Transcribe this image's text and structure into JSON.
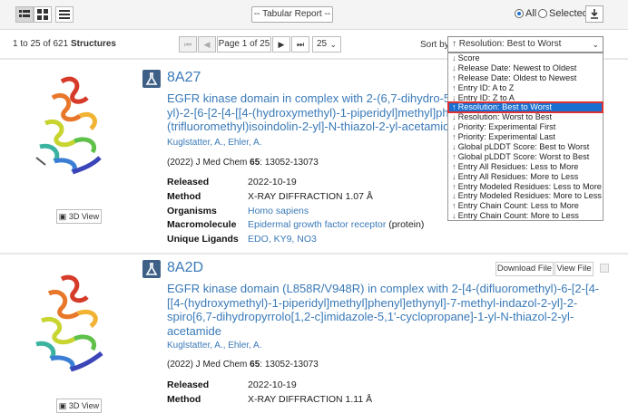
{
  "toolbar": {
    "report_select": "-- Tabular Report --",
    "scope_all": "All",
    "scope_selected": "Selected"
  },
  "pager": {
    "range": "1 to 25 of 621",
    "noun": "Structures",
    "page_text": "Page 1 of 25",
    "per_page": "25",
    "sort_label": "Sort by",
    "sort_value": "↑ Resolution: Best to Worst"
  },
  "sort_options": [
    {
      "arrow": "↓",
      "label": "Score"
    },
    {
      "arrow": "↓",
      "label": "Release Date: Newest to Oldest"
    },
    {
      "arrow": "↑",
      "label": "Release Date: Oldest to Newest"
    },
    {
      "arrow": "↑",
      "label": "Entry ID: A to Z"
    },
    {
      "arrow": "↓",
      "label": "Entry ID: Z to A"
    },
    {
      "arrow": "↑",
      "label": "Resolution: Best to Worst",
      "selected": true
    },
    {
      "arrow": "↓",
      "label": "Resolution: Worst to Best"
    },
    {
      "arrow": "↓",
      "label": "Priority: Experimental First"
    },
    {
      "arrow": "↑",
      "label": "Priority: Experimental Last"
    },
    {
      "arrow": "↓",
      "label": "Global pLDDT Score: Best to Worst"
    },
    {
      "arrow": "↑",
      "label": "Global pLDDT Score: Worst to Best"
    },
    {
      "arrow": "↑",
      "label": "Entry All Residues: Less to More"
    },
    {
      "arrow": "↓",
      "label": "Entry All Residues: More to Less"
    },
    {
      "arrow": "↑",
      "label": "Entry Modeled Residues: Less to More"
    },
    {
      "arrow": "↓",
      "label": "Entry Modeled Residues: More to Less"
    },
    {
      "arrow": "↑",
      "label": "Entry Chain Count: Less to More"
    },
    {
      "arrow": "↓",
      "label": "Entry Chain Count: More to Less"
    }
  ],
  "results": [
    {
      "id": "8A27",
      "title": "EGFR kinase domain in complex with 2-(6,7-dihydro-5H-pyrrolo[1,2-c]imidazol-1-yl)-2-[6-[2-[4-[[4-(hydroxymethyl)-1-piperidyl]methyl]phenyl]ethynyl]-4-oxo-7-(trifluoromethyl)isoindolin-2-yl]-N-thiazol-2-yl-acetamide",
      "title_lines": [
        "EGFR kinase domain in complex with 2-(6,7-dihydro-5",
        "yl)-2-[6-[2-[4-[[4-(hydroxymethyl)-1-piperidyl]methyl]ph",
        "(trifluoromethyl)isoindolin-2-yl]-N-thiazol-2-yl-acetamid"
      ],
      "authors": "Kuglstatter, A., Ehler, A.",
      "journal_pre": "(2022) J Med Chem ",
      "journal_vol": "65",
      "journal_post": ": 13052-13073",
      "released_label": "Released",
      "released": "2022-10-19",
      "method_label": "Method",
      "method": "X-RAY DIFFRACTION 1.07 Å",
      "organisms_label": "Organisms",
      "organism": "Homo sapiens",
      "macromolecule_label": "Macromolecule",
      "macromolecule": "Epidermal growth factor receptor",
      "macromolecule_type": " (protein)",
      "ligands_label": "Unique Ligands",
      "ligands": "EDO, KY9, NO3",
      "view3d": "3D View"
    },
    {
      "id": "8A2D",
      "title_lines": [
        "EGFR kinase domain (L858R/V948R) in complex with 2-[4-(difluoromethyl)-6-[2-[4-",
        "[[4-(hydroxymethyl)-1-piperidyl]methyl]phenyl]ethynyl]-7-methyl-indazol-2-yl]-2-",
        "spiro[6,7-dihydropyrrolo[1,2-c]imidazole-5,1'-cyclopropane]-1-yl-N-thiazol-2-yl-",
        "acetamide"
      ],
      "authors": "Kuglstatter, A., Ehler, A.",
      "journal_pre": "(2022) J Med Chem ",
      "journal_vol": "65",
      "journal_post": ": 13052-13073",
      "released_label": "Released",
      "released": "2022-10-19",
      "method_label": "Method",
      "method": "X-RAY DIFFRACTION 1.11 Å",
      "download_file": "Download File",
      "view_file": "View File",
      "view3d": "3D View"
    }
  ]
}
